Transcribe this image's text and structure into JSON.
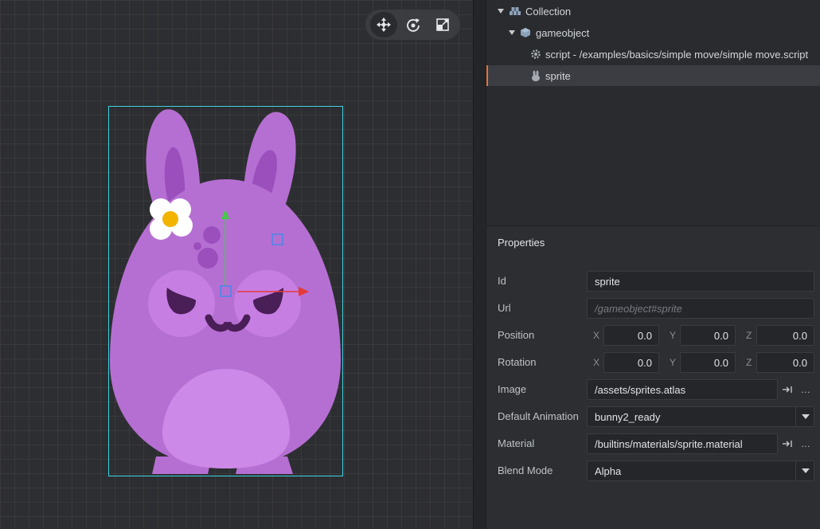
{
  "viewport": {
    "tools": [
      {
        "name": "move-tool",
        "icon": "move-arrows-icon",
        "active": true
      },
      {
        "name": "rotate-tool",
        "icon": "rotate-icon",
        "active": false
      },
      {
        "name": "scale-tool",
        "icon": "scale-icon",
        "active": false
      }
    ],
    "selection_color": "#3fd3e0"
  },
  "outline": {
    "items": [
      {
        "label": "Collection",
        "icon": "collection-icon"
      },
      {
        "label": "gameobject",
        "icon": "gameobject-icon"
      },
      {
        "label": "script - /examples/basics/simple move/simple move.script",
        "icon": "gear-icon"
      },
      {
        "label": "sprite",
        "icon": "sprite-icon",
        "selected": true
      }
    ]
  },
  "properties": {
    "title": "Properties",
    "id": {
      "label": "Id",
      "value": "sprite"
    },
    "url": {
      "label": "Url",
      "value": "/gameobject#sprite"
    },
    "position": {
      "label": "Position",
      "x_label": "X",
      "y_label": "Y",
      "z_label": "Z",
      "x": "0.0",
      "y": "0.0",
      "z": "0.0"
    },
    "rotation": {
      "label": "Rotation",
      "x_label": "X",
      "y_label": "Y",
      "z_label": "Z",
      "x": "0.0",
      "y": "0.0",
      "z": "0.0"
    },
    "image": {
      "label": "Image",
      "value": "/assets/sprites.atlas",
      "more": "…"
    },
    "default_animation": {
      "label": "Default Animation",
      "value": "bunny2_ready"
    },
    "material": {
      "label": "Material",
      "value": "/builtins/materials/sprite.material",
      "more": "…"
    },
    "blend_mode": {
      "label": "Blend Mode",
      "value": "Alpha"
    }
  }
}
